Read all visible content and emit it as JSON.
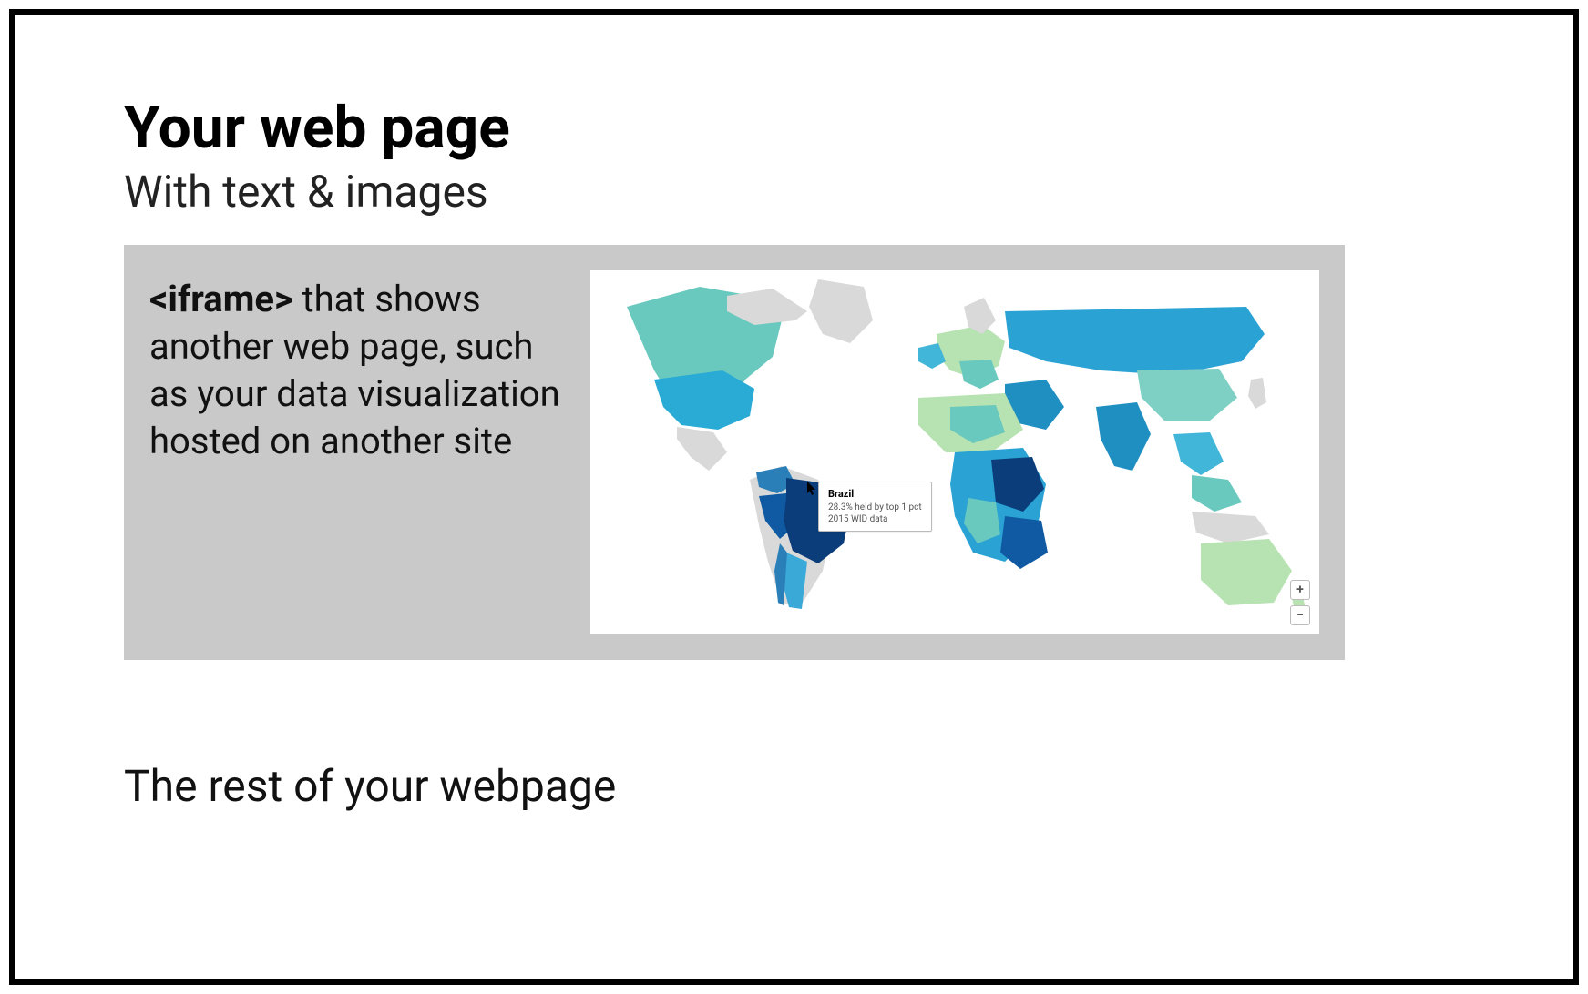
{
  "header": {
    "title": "Your web page",
    "subtitle": "With text & images"
  },
  "iframe_box": {
    "bold": "<iframe>",
    "rest": " that shows another web page, such as your data visualization hosted on another site"
  },
  "map": {
    "tooltip": {
      "title": "Brazil",
      "line1": "28.3% held by top 1 pct",
      "line2": "2015 WID data"
    },
    "zoom": {
      "in": "+",
      "out": "−"
    }
  },
  "footer": "The rest of your webpage"
}
